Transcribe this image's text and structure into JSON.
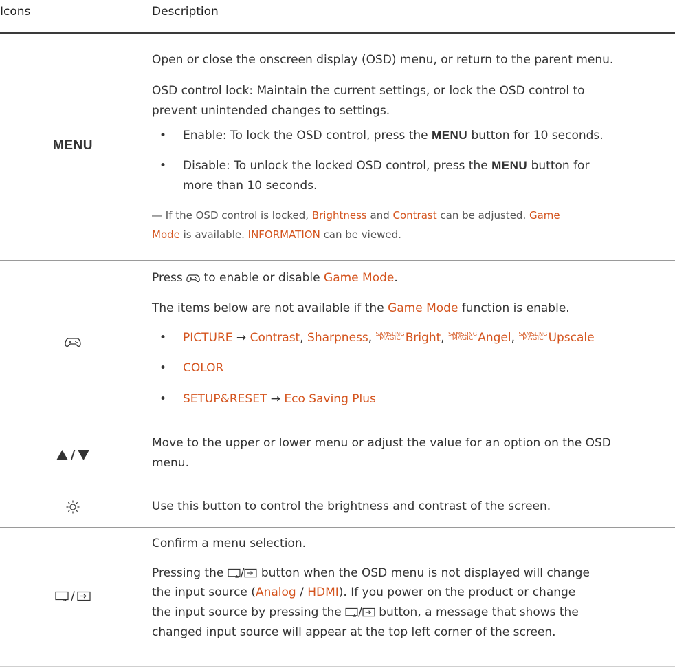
{
  "header": {
    "col_icons": "Icons",
    "col_description": "Description"
  },
  "rows": [
    {
      "icon_label": "MENU",
      "line1": "Open or close the onscreen display (OSD) menu, or return to the parent menu.",
      "line2a": "OSD control lock: Maintain the current settings, or lock the OSD control to",
      "line2b": "prevent unintended changes to settings.",
      "bullet1_pre": "Enable: To lock the OSD control, press the ",
      "bullet1_key": "MENU",
      "bullet1_post": " button for 10 seconds.",
      "bullet2_pre": "Disable: To unlock the locked OSD control, press the ",
      "bullet2_key": "MENU",
      "bullet2_post": " button for",
      "bullet2_cont": "more than 10 seconds.",
      "note_dash": "―",
      "note_a1": " If the OSD control is locked, ",
      "note_brightness": "Brightness",
      "note_and": " and ",
      "note_contrast": "Contrast",
      "note_a2": " can be adjusted. ",
      "note_game": "Game",
      "note_mode": "Mode",
      "note_b1": " is available. ",
      "note_information": "INFORMATION",
      "note_b2": " can be viewed."
    },
    {
      "icon": "gamepad-icon",
      "line1_pre": "Press ",
      "line1_mid": " to enable or disable ",
      "line1_hl": "Game Mode",
      "line1_post": ".",
      "line2_pre": "The items below are not available if the ",
      "line2_hl": "Game Mode",
      "line2_post": " function is enable.",
      "b1_picture": "PICTURE",
      "b1_arrow": " → ",
      "b1_contrast": "Contrast",
      "b1_comma1": ", ",
      "b1_sharpness": "Sharpness",
      "b1_comma2": ", ",
      "magic_top": "SAMSUNG",
      "magic_bottom": "MAGIC",
      "b1_bright": "Bright",
      "b1_comma3": ", ",
      "b1_angel": "Angel",
      "b1_comma4": ", ",
      "b1_upscale": "Upscale",
      "b2_color": "COLOR",
      "b3_setup": "SETUP&RESET",
      "b3_arrow": " → ",
      "b3_eco": "Eco Saving Plus"
    },
    {
      "icon": "up-down-arrows-icon",
      "icon_sep": "/",
      "line1": "Move to the upper or lower menu or adjust the value for an option on the OSD",
      "line2": "menu."
    },
    {
      "icon": "brightness-icon",
      "line1": "Use this button to control the brightness and contrast of the screen."
    },
    {
      "icon": "source-enter-icon",
      "icon_sep": "/",
      "line1": "Confirm a menu selection.",
      "line2_pre": "Pressing the ",
      "line2_post": " button when the OSD menu is not displayed will change",
      "line3_pre": "the input source (",
      "line3_analog": "Analog",
      "line3_sep": " / ",
      "line3_hdmi": "HDMI",
      "line3_post": "). If you power on the product or change",
      "line4_pre": "the input source by pressing the ",
      "line4_post": " button, a message that shows the",
      "line5": "changed input source will appear at the top left corner of the screen."
    }
  ],
  "colors": {
    "highlight": "#d4541e",
    "text": "#333333",
    "rule": "#9a9a9a"
  }
}
